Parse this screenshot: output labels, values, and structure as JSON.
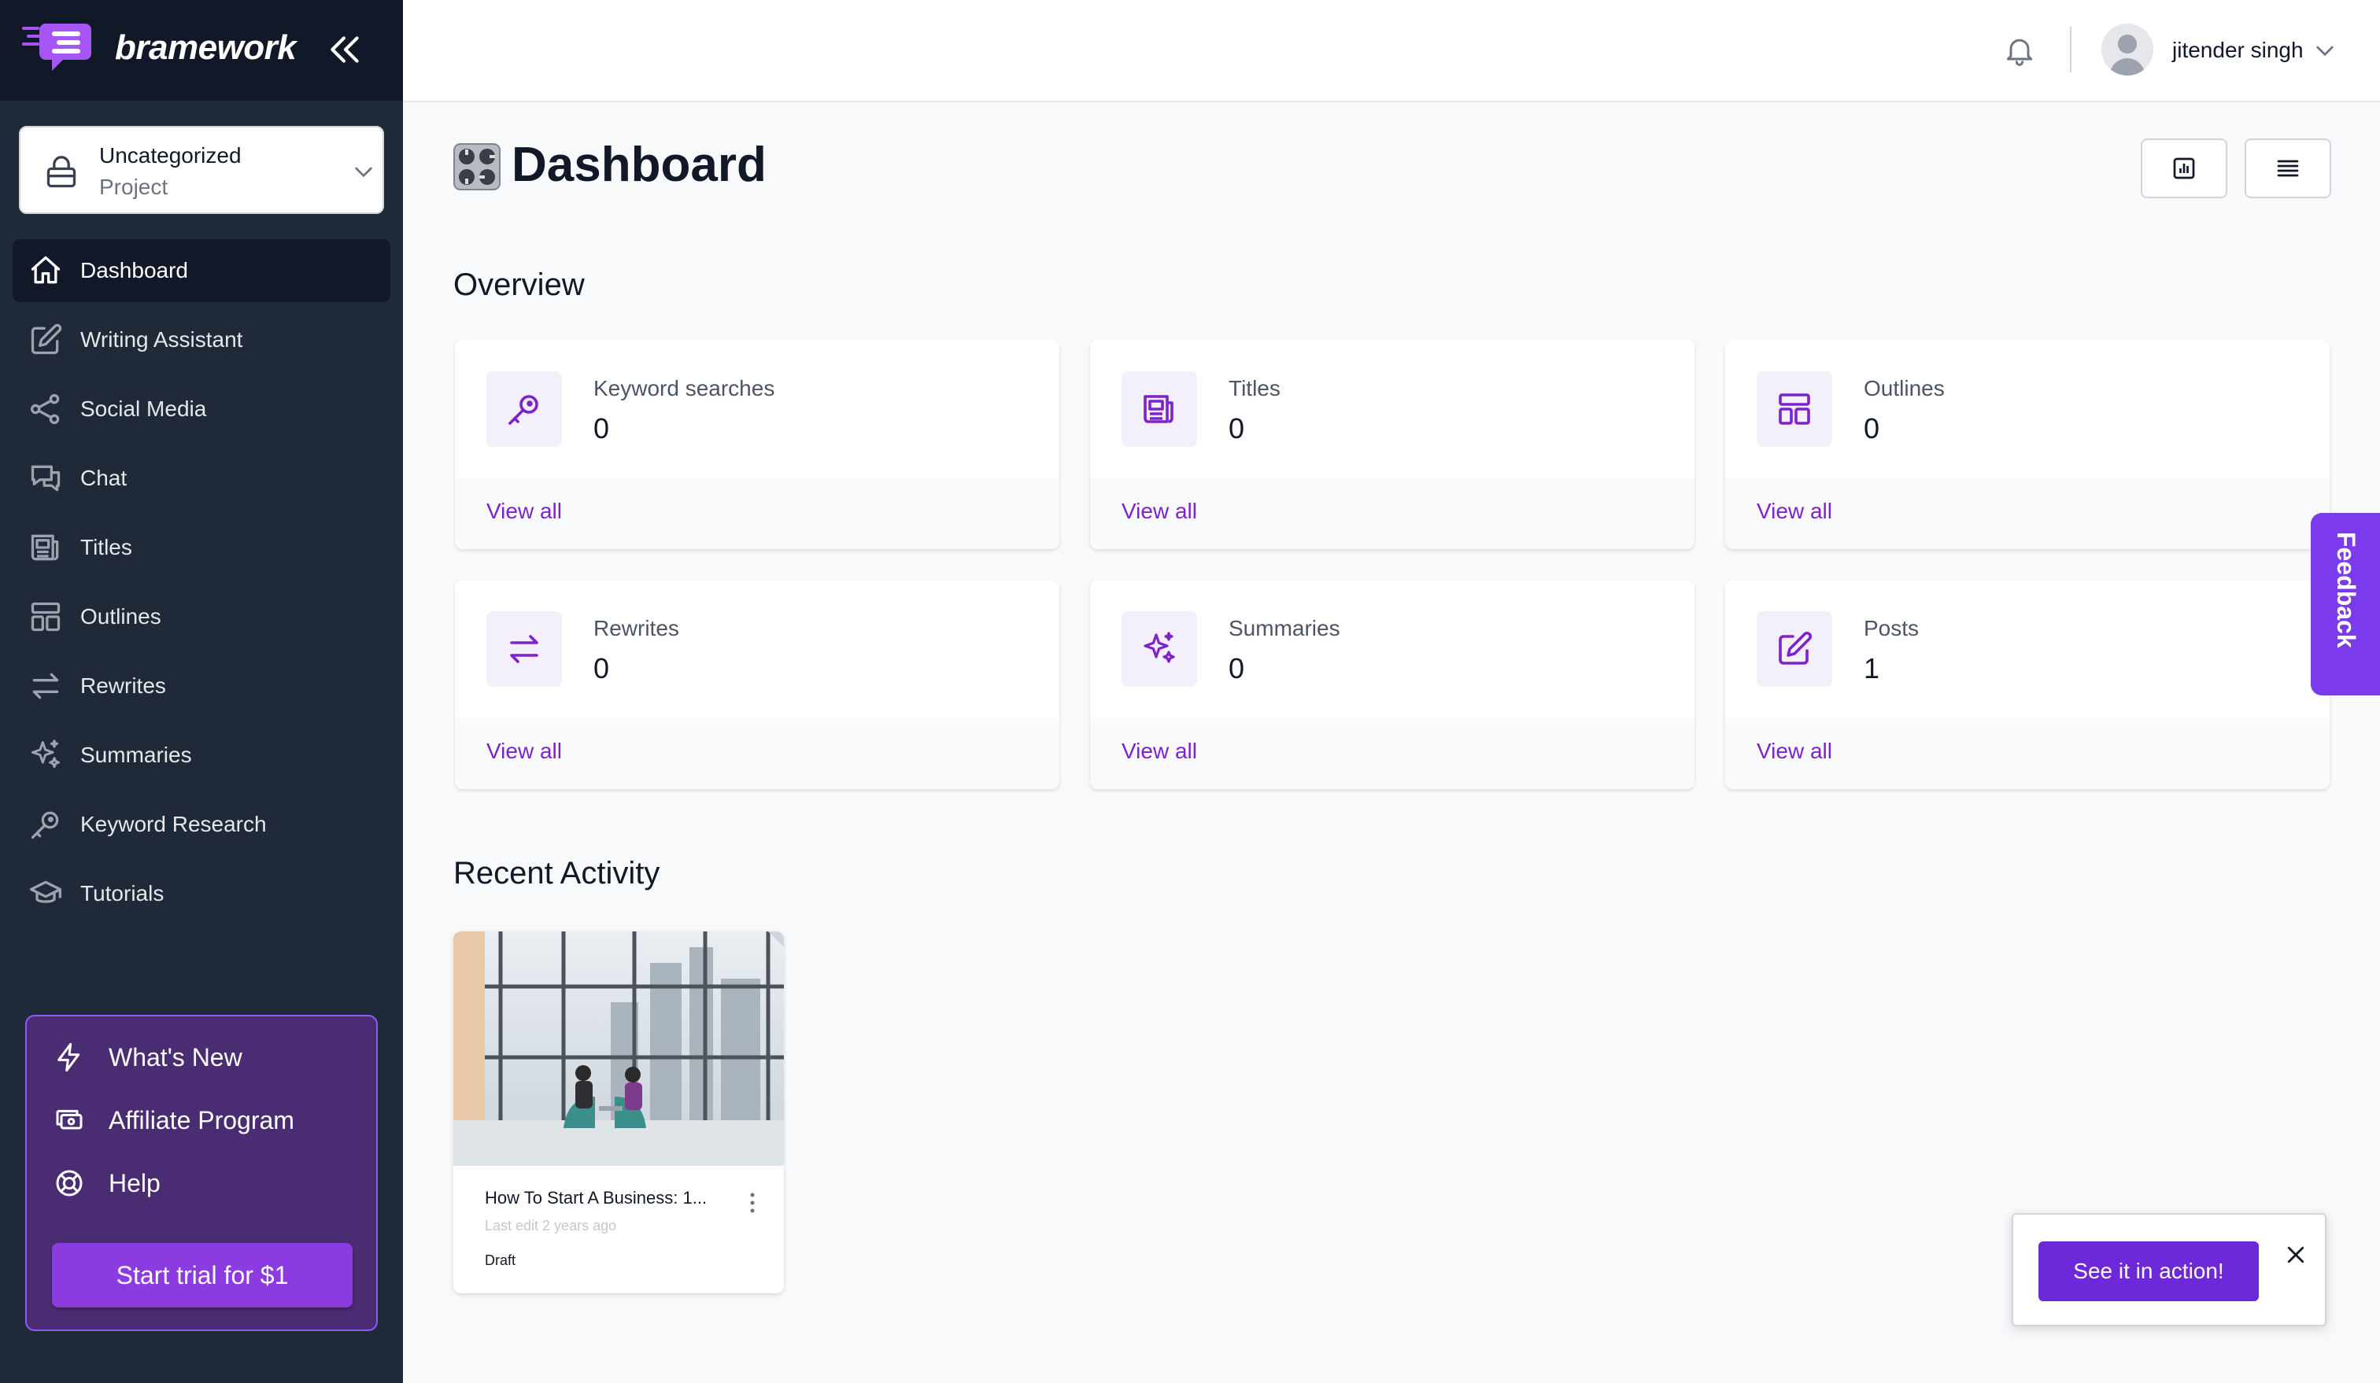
{
  "brand": {
    "name": "bramework"
  },
  "project": {
    "line1": "Uncategorized",
    "line2": "Project"
  },
  "sidebar": {
    "items": [
      {
        "label": "Dashboard",
        "icon": "home-icon",
        "active": true
      },
      {
        "label": "Writing Assistant",
        "icon": "edit-icon"
      },
      {
        "label": "Social Media",
        "icon": "share-icon"
      },
      {
        "label": "Chat",
        "icon": "chat-icon"
      },
      {
        "label": "Titles",
        "icon": "newspaper-icon"
      },
      {
        "label": "Outlines",
        "icon": "layout-icon"
      },
      {
        "label": "Rewrites",
        "icon": "arrows-icon"
      },
      {
        "label": "Summaries",
        "icon": "sparkles-icon"
      },
      {
        "label": "Keyword Research",
        "icon": "key-icon"
      },
      {
        "label": "Tutorials",
        "icon": "graduation-cap-icon"
      }
    ]
  },
  "promo": {
    "items": [
      {
        "label": "What's New",
        "icon": "lightning-icon"
      },
      {
        "label": "Affiliate Program",
        "icon": "cash-icon"
      },
      {
        "label": "Help",
        "icon": "lifebuoy-icon"
      }
    ],
    "trial_label": "Start trial for $1"
  },
  "header": {
    "username": "jitender singh"
  },
  "page": {
    "title": "Dashboard"
  },
  "overview": {
    "title": "Overview",
    "cards": [
      {
        "label": "Keyword searches",
        "value": "0",
        "link": "View all",
        "icon": "key-icon"
      },
      {
        "label": "Titles",
        "value": "0",
        "link": "View all",
        "icon": "newspaper-icon"
      },
      {
        "label": "Outlines",
        "value": "0",
        "link": "View all",
        "icon": "layout-icon"
      },
      {
        "label": "Rewrites",
        "value": "0",
        "link": "View all",
        "icon": "arrows-icon"
      },
      {
        "label": "Summaries",
        "value": "0",
        "link": "View all",
        "icon": "sparkles-icon"
      },
      {
        "label": "Posts",
        "value": "1",
        "link": "View all",
        "icon": "pencil-square-icon"
      }
    ]
  },
  "recent": {
    "title": "Recent Activity",
    "post": {
      "title": "How To Start A Business: 1...",
      "edited": "Last edit 2 years ago",
      "status": "Draft"
    }
  },
  "feedback": {
    "label": "Feedback"
  },
  "toast": {
    "button": "See it in action!"
  },
  "colors": {
    "accent": "#7c3aed",
    "sidebar": "#1f2937",
    "sidebar_dark": "#111827",
    "link": "#7e22ce"
  }
}
